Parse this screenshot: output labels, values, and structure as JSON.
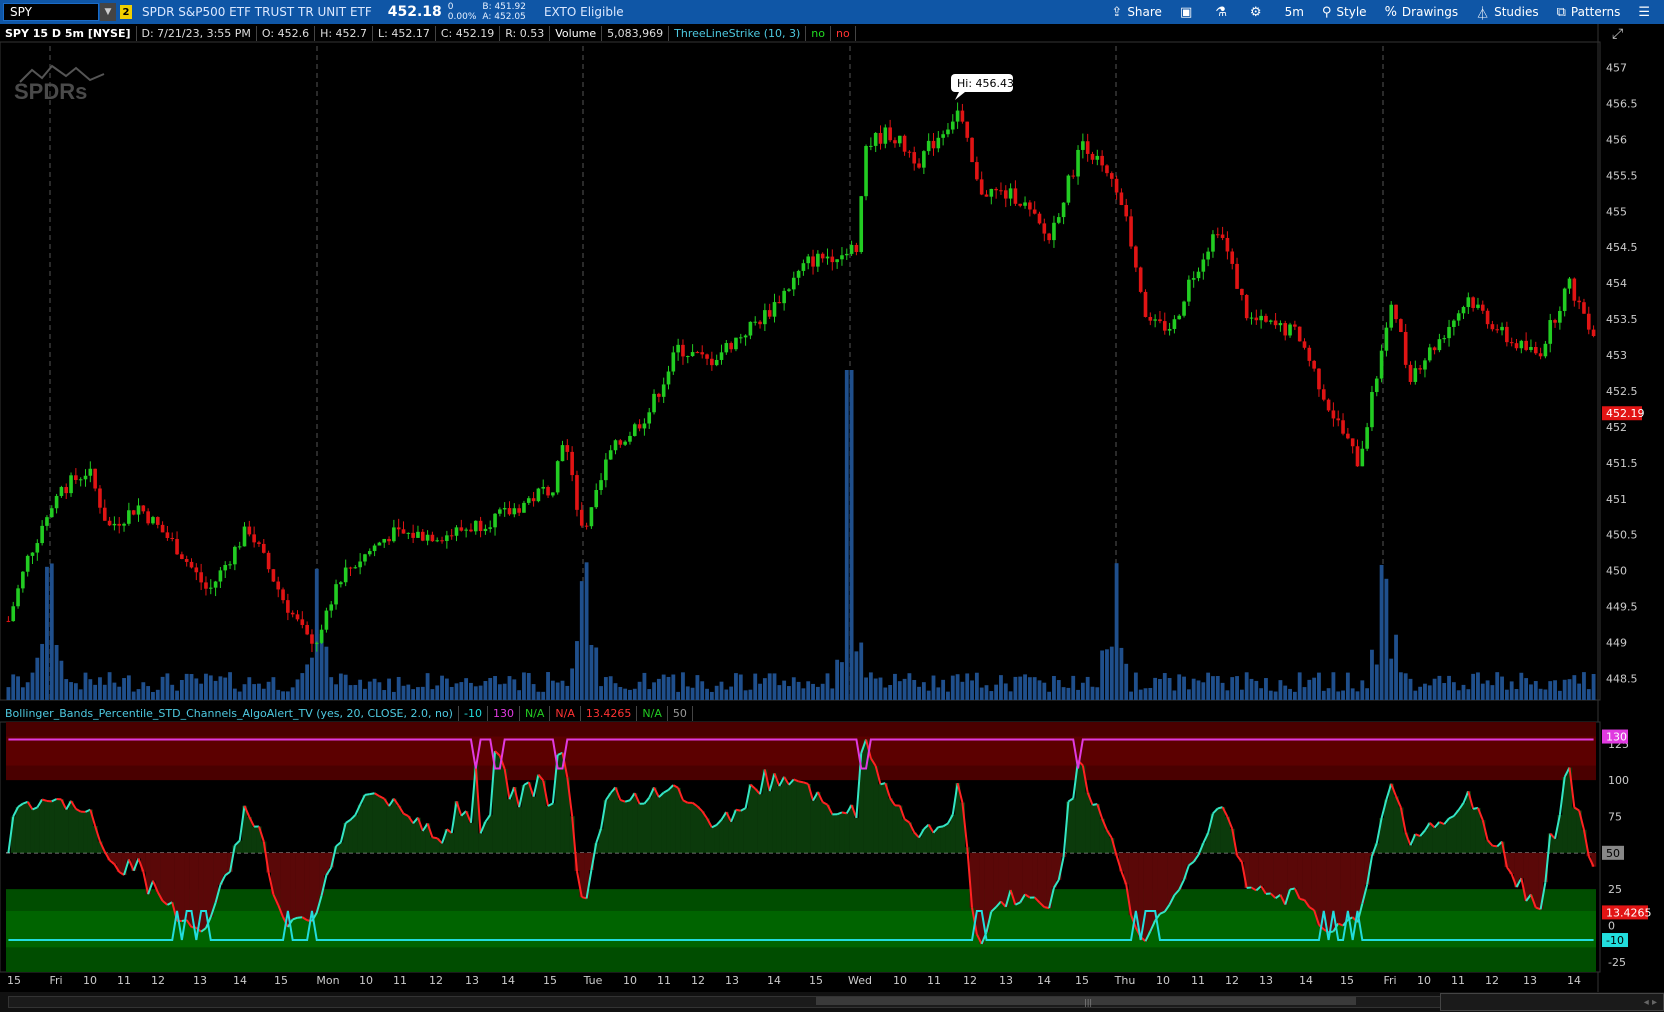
{
  "topbar": {
    "symbol": "SPY",
    "link_badge": "2",
    "title": "SPDR S&P500 ETF TRUST TR UNIT ETF",
    "last": "452.18",
    "change": "0",
    "change_pct": "0.00%",
    "bid": "B: 451.92",
    "ask": "A: 452.05",
    "exto": "EXTO Eligible",
    "buttons": [
      {
        "id": "share",
        "label": "Share",
        "icon": "share-icon"
      },
      {
        "id": "flexgrid",
        "label": "",
        "icon": "flexgrid-icon"
      },
      {
        "id": "lab",
        "label": "",
        "icon": "beaker-icon"
      },
      {
        "id": "settings",
        "label": "",
        "icon": "gear-icon"
      },
      {
        "id": "timeframe",
        "label": "5m",
        "icon": ""
      },
      {
        "id": "style",
        "label": "Style",
        "icon": "style-icon"
      },
      {
        "id": "drawings",
        "label": "Drawings",
        "icon": "percent-icon"
      },
      {
        "id": "studies",
        "label": "Studies",
        "icon": "flask-icon"
      },
      {
        "id": "patterns",
        "label": "Patterns",
        "icon": "pattern-icon"
      },
      {
        "id": "menu",
        "label": "",
        "icon": "list-icon"
      }
    ]
  },
  "header": {
    "symbol_period": "SPY 15 D 5m [NYSE]",
    "date": "D: 7/21/23, 3:55 PM",
    "open": "O: 452.6",
    "high": "H: 452.7",
    "low": "L: 452.17",
    "close": "C: 452.19",
    "range": "R: 0.53",
    "volume_label": "Volume",
    "volume_value": "5,083,969",
    "study": "ThreeLineStrike (10, 3)",
    "study_v1": "no",
    "study_v2": "no"
  },
  "price_panel": {
    "hi_bubble": "Hi: 456.43",
    "last_tag": "452.19",
    "y_ticks": [
      "457",
      "456.5",
      "456",
      "455.5",
      "455",
      "454.5",
      "454",
      "453.5",
      "453",
      "452.5",
      "452",
      "451.5",
      "451",
      "450.5",
      "450",
      "449.5",
      "449",
      "448.5"
    ]
  },
  "indicator": {
    "title": "Bollinger_Bands_Percentile_STD_Channels_AlgoAlert_TV (yes, 20, CLOSE, 2.0, no)",
    "values": [
      "-10",
      "130",
      "N/A",
      "N/A",
      "13.4265",
      "N/A",
      "50"
    ],
    "y_ticks": [
      "125",
      "100",
      "75",
      "50",
      "25",
      "0",
      "-25"
    ],
    "tag_upper": "130",
    "tag_mid": "50",
    "tag_value": "13.4265",
    "tag_lower": "-10"
  },
  "x_axis": [
    "15",
    "Fri",
    "10",
    "11",
    "12",
    "13",
    "14",
    "15",
    "Mon",
    "10",
    "11",
    "12",
    "13",
    "14",
    "15",
    "Tue",
    "10",
    "11",
    "12",
    "13",
    "14",
    "15",
    "Wed",
    "10",
    "11",
    "12",
    "13",
    "14",
    "15",
    "Thu",
    "10",
    "11",
    "12",
    "13",
    "14",
    "15",
    "Fri",
    "10",
    "11",
    "12",
    "13",
    "14"
  ],
  "colors": {
    "bull": "#22cc22",
    "bear": "#e01414",
    "volume": "#1f4f8c",
    "osc_up": "#33e6c4",
    "osc_down": "#ff2222",
    "magenta": "#e03ae0",
    "cyan": "#22dddd",
    "toolbar": "#0f56a6"
  },
  "logo_text": "SPDRs"
}
